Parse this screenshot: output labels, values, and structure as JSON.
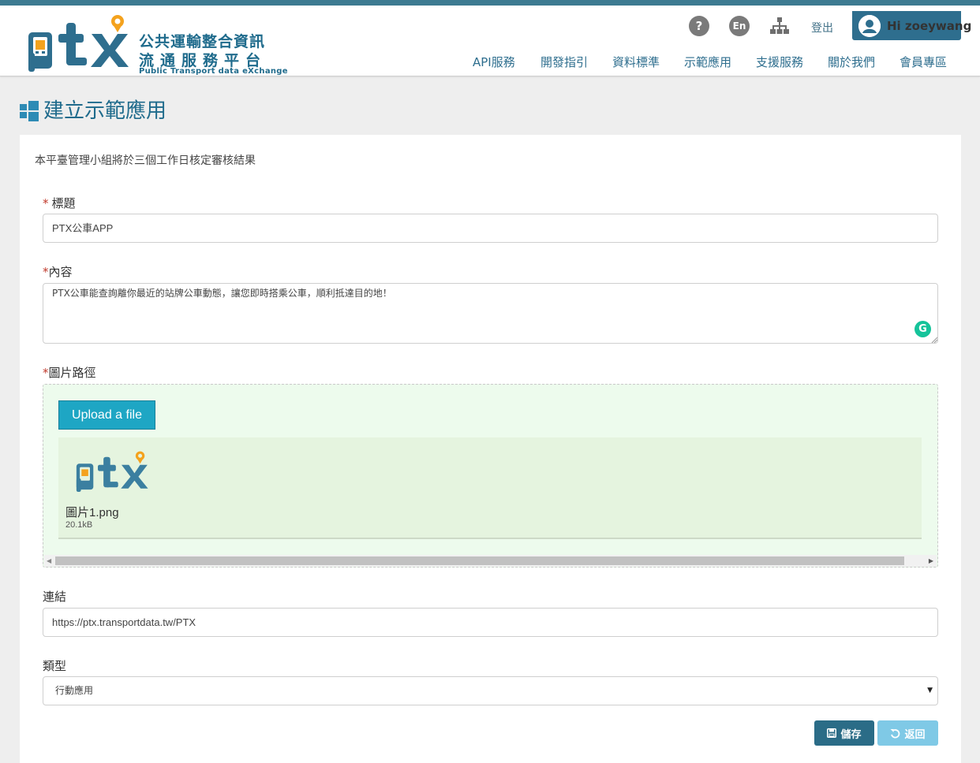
{
  "brand": {
    "name_cn_line1": "公共運輸整合資訊",
    "name_cn_line2": "流通服務平台",
    "name_en": "Public Transport data eXchange",
    "colors": {
      "primary": "#2e6e8e",
      "accent": "#f4a21d",
      "topbar": "#3d7b91"
    }
  },
  "utilities": {
    "help_icon": "question-circle-icon",
    "help_glyph": "?",
    "lang_icon": "language-en-icon",
    "lang_glyph": "En",
    "sitemap_icon": "sitemap-icon",
    "logout_label": "登出",
    "user_label": "Hi zoeywang",
    "user_icon": "user-avatar-icon"
  },
  "nav": {
    "items": [
      {
        "label": "API服務"
      },
      {
        "label": "開發指引"
      },
      {
        "label": "資料標準"
      },
      {
        "label": "示範應用"
      },
      {
        "label": "支援服務"
      },
      {
        "label": "關於我們"
      },
      {
        "label": "會員專區"
      }
    ]
  },
  "page": {
    "title": "建立示範應用",
    "title_icon": "windows-icon",
    "notice": "本平臺管理小組將於三個工作日核定審核結果"
  },
  "form": {
    "title_field": {
      "label": "標題",
      "required_mark": "*",
      "value": "PTX公車APP"
    },
    "content_field": {
      "label": "內容",
      "required_mark": "*",
      "value": "PTX公車能查詢離你最近的站牌公車動態，讓您即時搭乘公車，順利抵達目的地！",
      "grammarly_icon": "grammarly-icon",
      "grammarly_glyph": "G"
    },
    "image_field": {
      "label": "圖片路徑",
      "required_mark": "*",
      "upload_label": "Upload a file",
      "file_name": "圖片1.png",
      "file_size": "20.1kB",
      "thumbnail_icon": "ptx-logo-thumbnail"
    },
    "link_field": {
      "label": "連結",
      "value": "https://ptx.transportdata.tw/PTX"
    },
    "type_field": {
      "label": "類型",
      "value": "行動應用"
    },
    "save_label": "儲存",
    "save_icon": "floppy-disk-icon",
    "back_label": "返回",
    "back_icon": "undo-icon"
  }
}
